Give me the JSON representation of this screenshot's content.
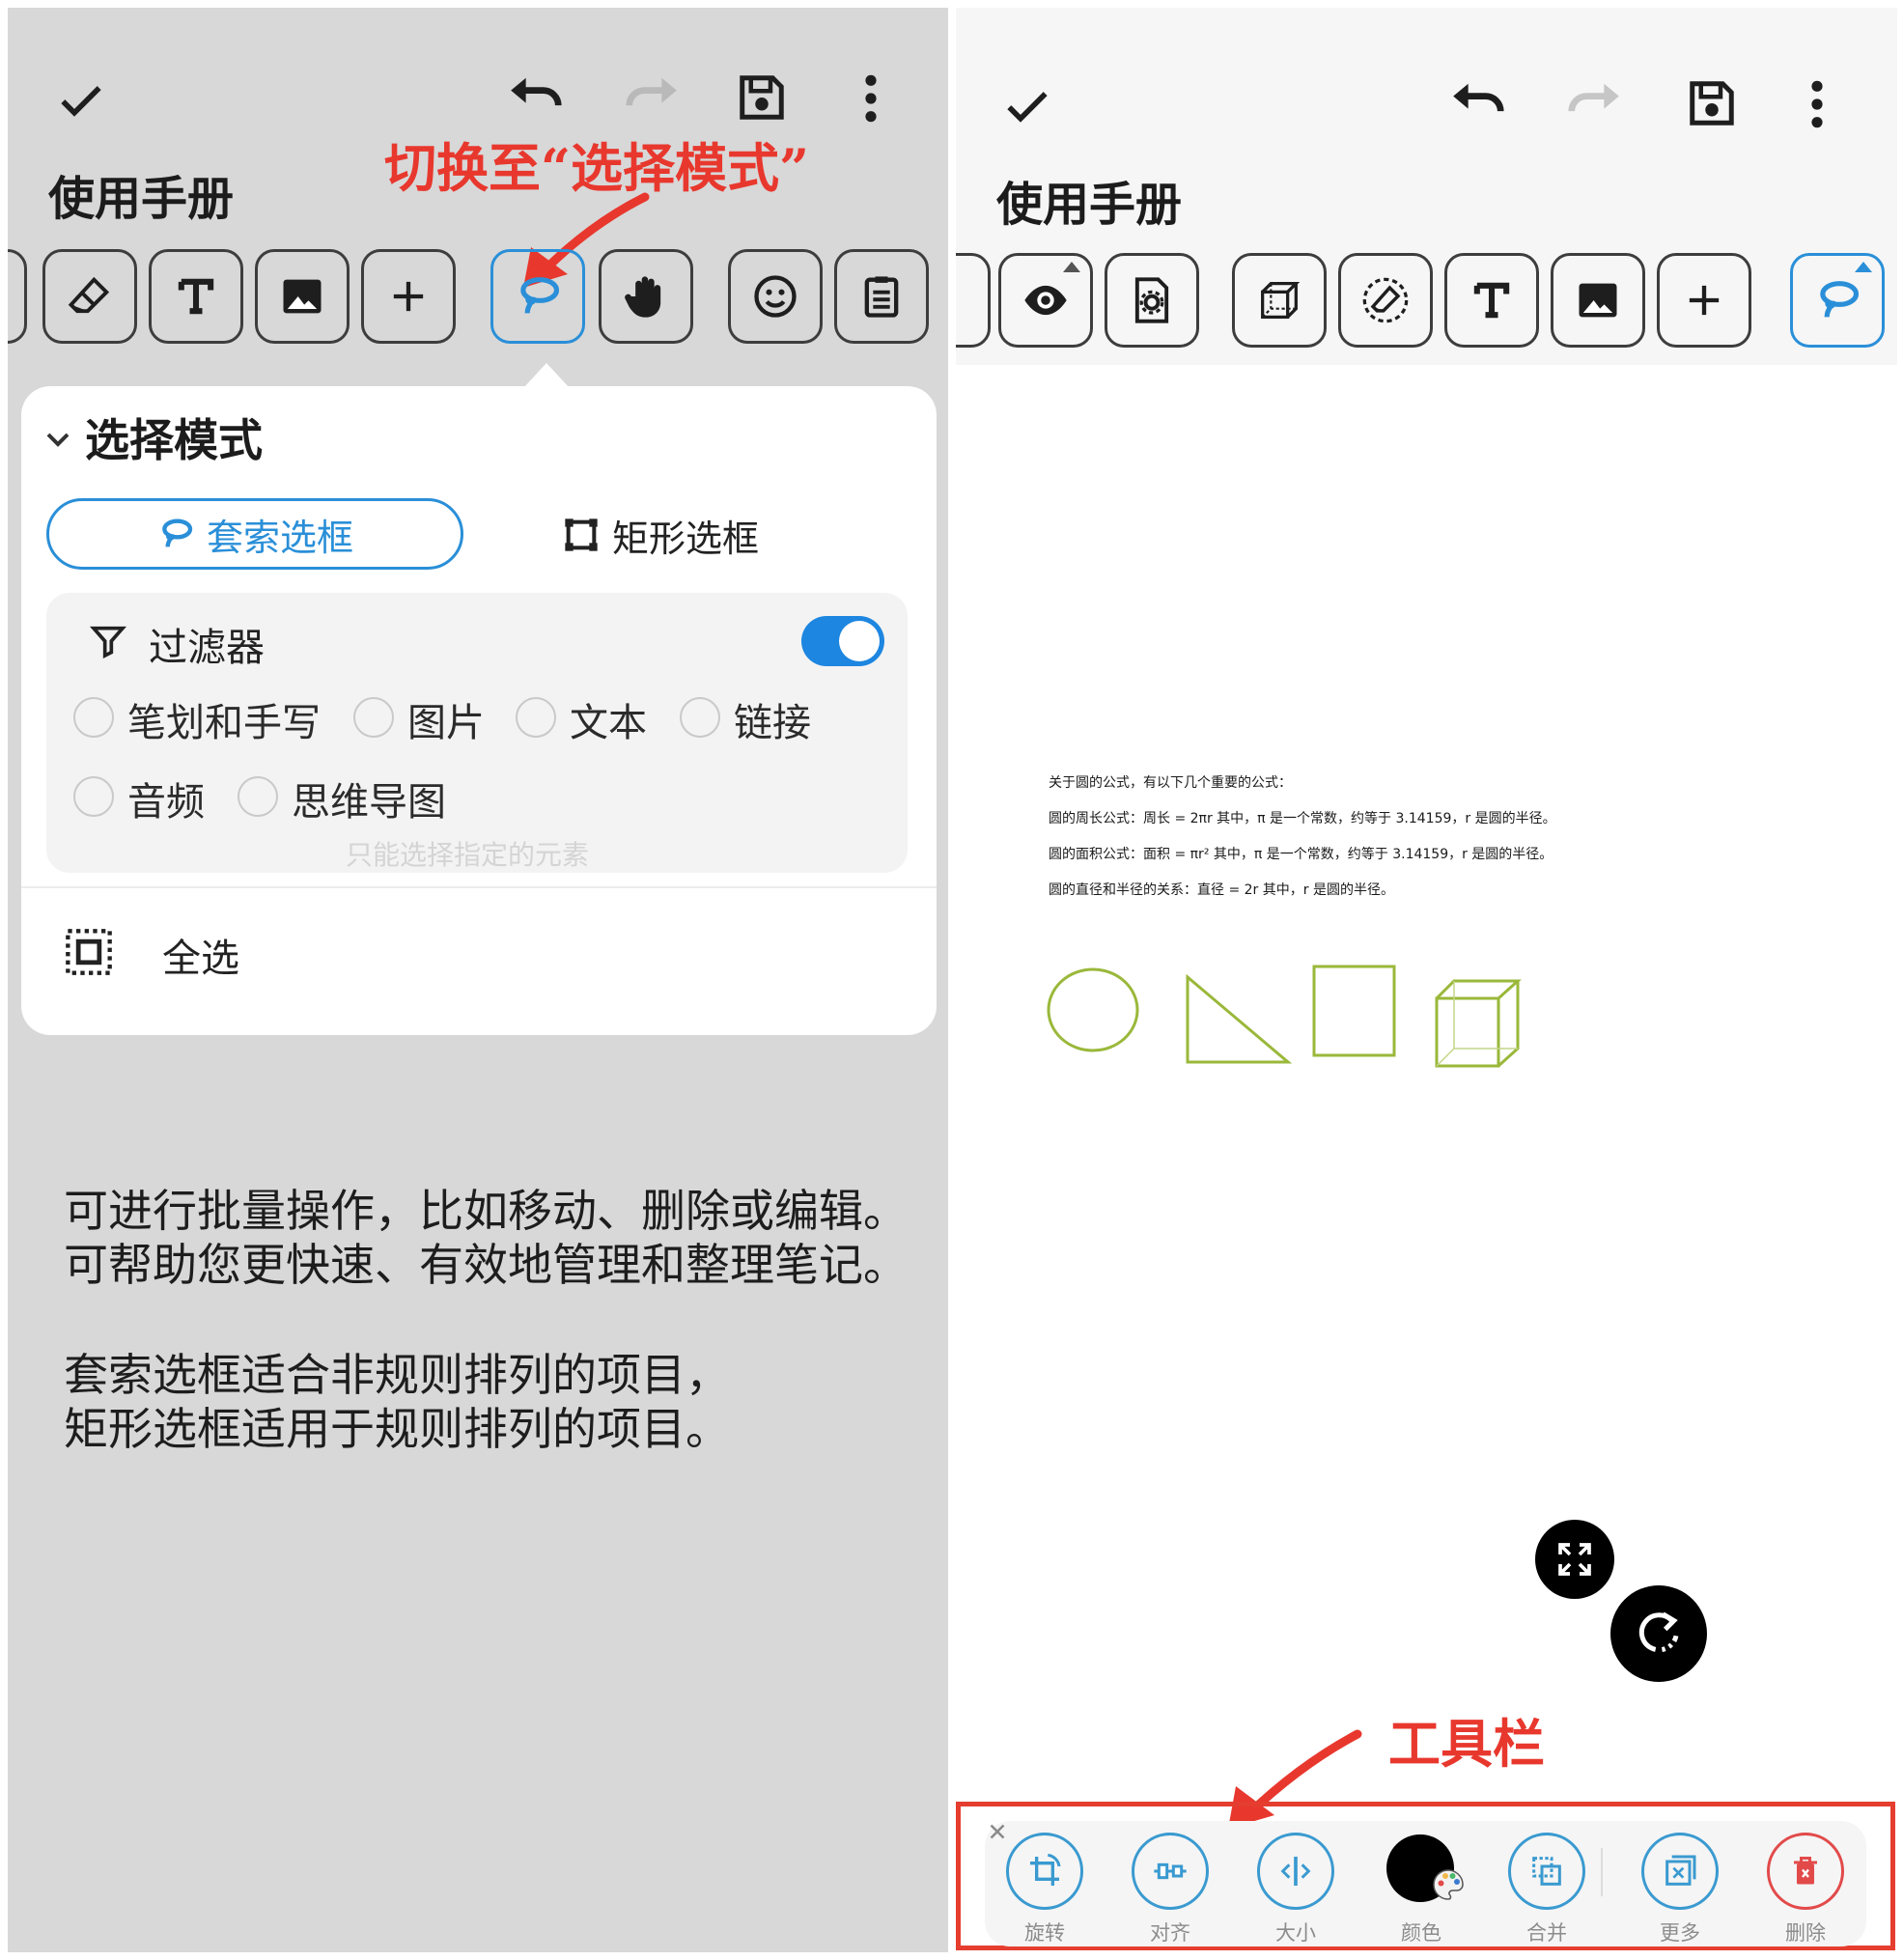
{
  "left": {
    "header_title": "使用手册",
    "annotation": "切换至“选择模式”",
    "popup": {
      "section_title": "选择模式",
      "lasso_label": "套索选框",
      "rect_label": "矩形选框",
      "filter_label": "过滤器",
      "filter_on": true,
      "options": [
        "笔划和手写",
        "图片",
        "文本",
        "链接",
        "音频",
        "思维导图"
      ],
      "hint": "只能选择指定的元素",
      "select_all": "全选"
    },
    "desc_1": "可进行批量操作，比如移动、删除或编辑。",
    "desc_2": "可帮助您更快速、有效地管理和整理笔记。",
    "desc_3": "套索选框适合非规则排列的项目，",
    "desc_4": "矩形选框适用于规则排列的项目。"
  },
  "right": {
    "header_title": "使用手册",
    "doc": {
      "line_1": "关于圆的公式，有以下几个重要的公式：",
      "line_2": "圆的周长公式：周长 = 2πr 其中，π 是一个常数，约等于 3.14159，r 是圆的半径。",
      "line_3": "圆的面积公式：面积 = πr² 其中，π 是一个常数，约等于 3.14159，r 是圆的半径。",
      "line_4": "圆的直径和半径的关系：直径 = 2r 其中，r 是圆的半径。"
    },
    "annotation": "工具栏",
    "toolbar": {
      "rotate": "旋转",
      "align": "对齐",
      "size": "大小",
      "color": "颜色",
      "merge": "合并",
      "more": "更多",
      "delete": "删除"
    },
    "shape_color": "#9ab83a",
    "accent_color": "#2a8fd8",
    "annotation_color": "#e8382e"
  }
}
